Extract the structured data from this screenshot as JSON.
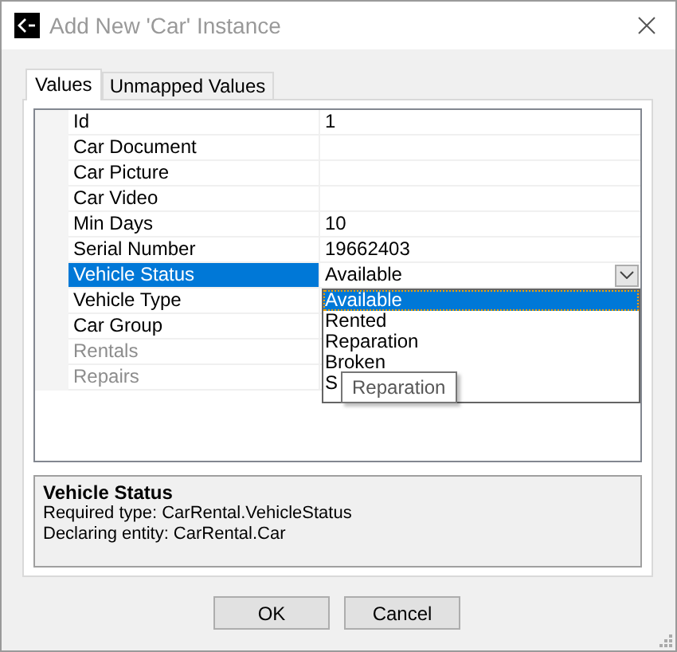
{
  "window": {
    "title": "Add New 'Car' Instance"
  },
  "tabs": [
    {
      "label": "Values",
      "selected": true
    },
    {
      "label": "Unmapped Values",
      "selected": false
    }
  ],
  "properties": [
    {
      "name": "Id",
      "kind": "text",
      "value": "1",
      "selected": false,
      "disabled": false
    },
    {
      "name": "Car Document",
      "kind": "text",
      "selected": false,
      "disabled": false
    },
    {
      "name": "Car Picture",
      "kind": "text",
      "selected": false,
      "disabled": false
    },
    {
      "name": "Car Video",
      "kind": "text",
      "selected": false,
      "disabled": false
    },
    {
      "name": "Min Days",
      "kind": "text",
      "value": "10",
      "selected": false,
      "disabled": false
    },
    {
      "name": "Serial Number",
      "kind": "text",
      "value": "19662403",
      "selected": false,
      "disabled": false
    },
    {
      "name": "Vehicle Status",
      "kind": "dropdown",
      "value": "Available",
      "selected": true,
      "disabled": false
    },
    {
      "name": "Vehicle Type",
      "kind": "text",
      "selected": false,
      "disabled": false
    },
    {
      "name": "Car Group",
      "kind": "text",
      "selected": false,
      "disabled": false
    },
    {
      "name": "Rentals",
      "kind": "text",
      "selected": false,
      "disabled": true
    },
    {
      "name": "Repairs",
      "kind": "text",
      "selected": false,
      "disabled": true
    }
  ],
  "dropdown_list": {
    "options": [
      {
        "label": "Available",
        "selected": true
      },
      {
        "label": "Rented",
        "selected": false
      },
      {
        "label": "Reparation",
        "selected": false
      },
      {
        "label": "Broken",
        "selected": false
      },
      {
        "label": "S",
        "selected": false
      }
    ]
  },
  "tooltip": {
    "text": "Reparation"
  },
  "description": {
    "title": "Vehicle Status",
    "lines": [
      "Required type: CarRental.VehicleStatus",
      "Declaring entity: CarRental.Car"
    ]
  },
  "buttons": [
    {
      "label": "OK"
    },
    {
      "label": "Cancel"
    }
  ]
}
